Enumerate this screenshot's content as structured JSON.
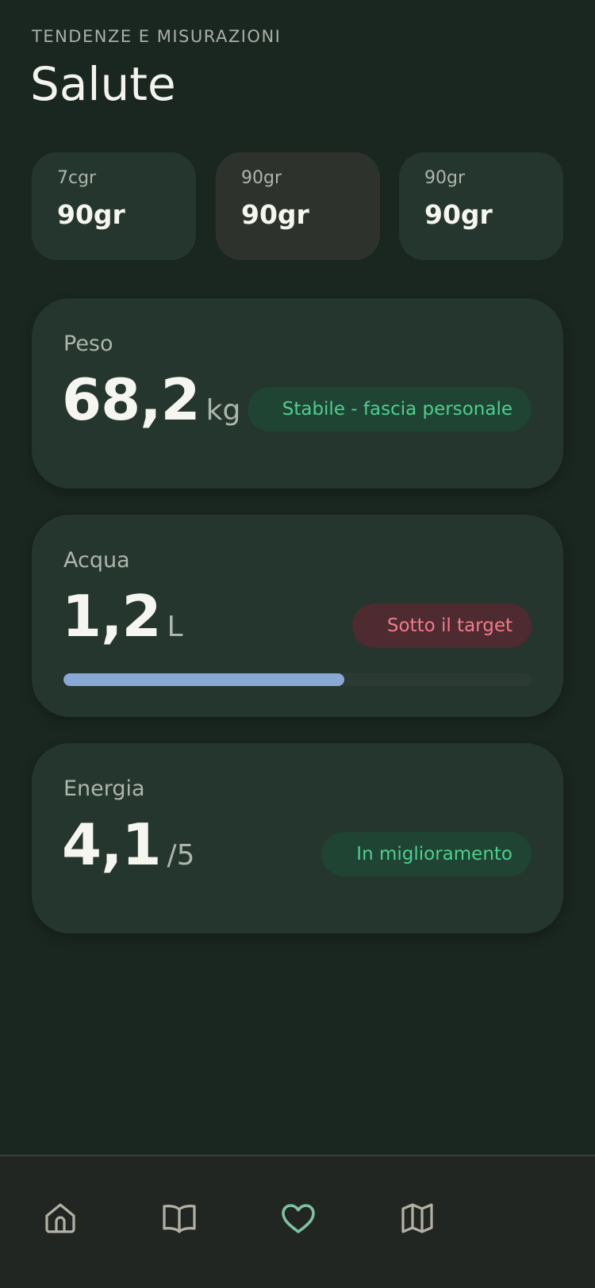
{
  "header": {
    "eyebrow": "TENDENZE E MISURAZIONI",
    "title": "Salute"
  },
  "summary_cards": [
    {
      "label": "7cgr",
      "value": "90gr"
    },
    {
      "label": "90gr",
      "value": "90gr"
    },
    {
      "label": "90gr",
      "value": "90gr"
    }
  ],
  "metrics": {
    "peso": {
      "label": "Peso",
      "value": "68,2",
      "unit": "kg",
      "status": "Stabile - fascia personale",
      "status_kind": "good"
    },
    "acqua": {
      "label": "Acqua",
      "value": "1,2",
      "unit": "L",
      "status": "Sotto il target",
      "status_kind": "bad",
      "progress_fraction": 0.6
    },
    "energia": {
      "label": "Energia",
      "value": "4,1",
      "unit": "/5",
      "status": "In miglioramento",
      "status_kind": "good"
    }
  },
  "bottom_nav": {
    "items": [
      {
        "icon": "home-icon",
        "active": false
      },
      {
        "icon": "book-icon",
        "active": false
      },
      {
        "icon": "heart-icon",
        "active": true
      },
      {
        "icon": "map-icon",
        "active": false
      }
    ]
  },
  "colors": {
    "background": "#1a2620",
    "card": "#24362d",
    "accent_good": "#4ecf8f",
    "accent_bad": "#f07c8a",
    "progress": "#8aa8d4",
    "nav_active": "#7fc2a0",
    "nav_inactive": "#b3b0a4"
  }
}
